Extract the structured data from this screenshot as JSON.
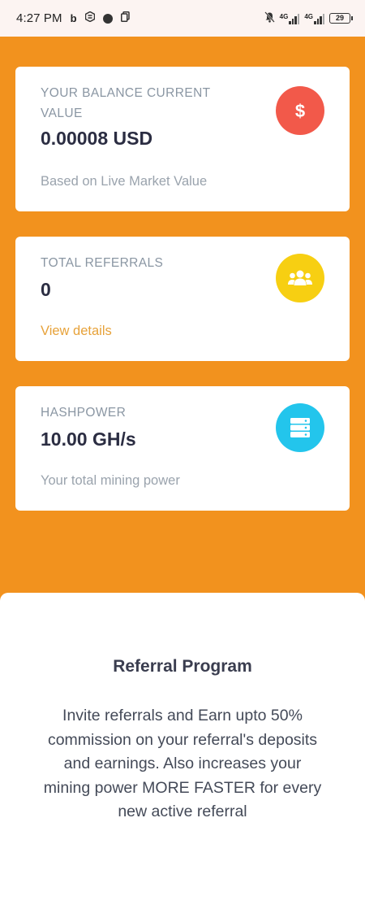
{
  "status_bar": {
    "time": "4:27 PM",
    "app_icons": [
      "b-app-icon",
      "coin-app-icon",
      "dot-icon",
      "copy-icon"
    ],
    "network1": "4G",
    "network2": "4G",
    "battery": "29"
  },
  "cards": {
    "balance": {
      "label": "YOUR BALANCE CURRENT VALUE",
      "value": "0.00008 USD",
      "sub": "Based on Live Market Value",
      "icon": "dollar-icon",
      "icon_color": "#f2594a"
    },
    "referrals": {
      "label": "TOTAL REFERRALS",
      "value": "0",
      "link": "View details",
      "icon": "users-icon",
      "icon_color": "#f7cf12"
    },
    "hashpower": {
      "label": "HASHPOWER",
      "value": "10.00 GH/s",
      "sub": "Your total mining power",
      "icon": "server-icon",
      "icon_color": "#23c5ec"
    }
  },
  "referral_program": {
    "title": "Referral Program",
    "text": "Invite referrals and Earn upto 50% commission on your referral's deposits and earnings. Also increases your mining power MORE FASTER for every new active referral"
  },
  "colors": {
    "background": "#f2921e",
    "status_bar": "#fcf4f2"
  }
}
